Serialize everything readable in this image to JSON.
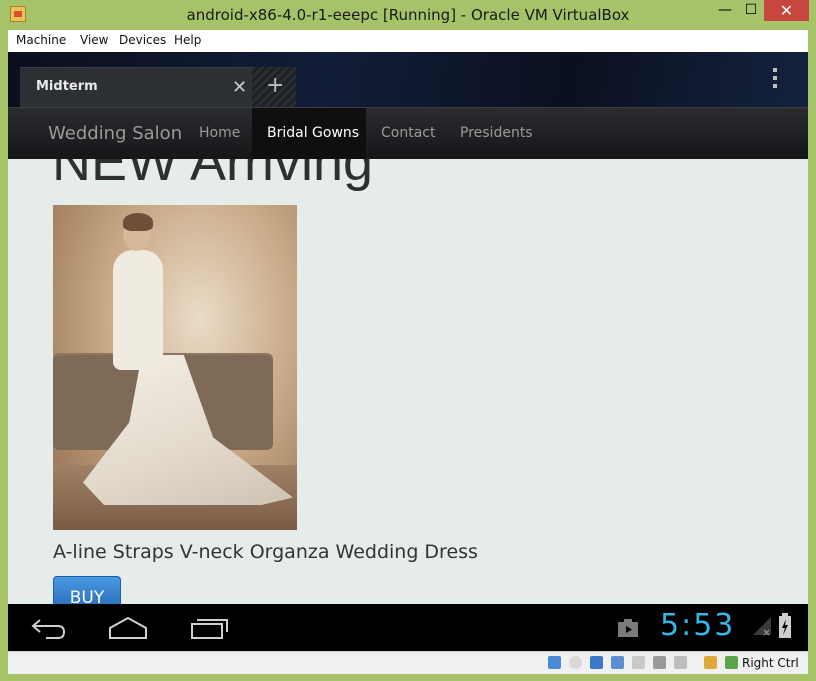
{
  "window": {
    "title": "android-x86-4.0-r1-eeepc [Running] - Oracle VM VirtualBox",
    "minimize": "—",
    "maximize": "☐",
    "close": "✕"
  },
  "menu": [
    "Machine",
    "View",
    "Devices",
    "Help"
  ],
  "browser": {
    "tab_title": "Midterm",
    "tab_close": "✕",
    "new_tab": "+"
  },
  "site": {
    "brand": "Wedding Salon",
    "nav": [
      "Home",
      "Bridal Gowns",
      "Contact",
      "Presidents"
    ],
    "active_nav": "Bridal Gowns",
    "headline": "NEW Arriving",
    "product_name": "A-line Straps V-neck Organza Wedding Dress",
    "buy_label": "BUY"
  },
  "android": {
    "clock": "5:53",
    "nav_icons": [
      "back-icon",
      "home-icon",
      "recent-apps-icon"
    ]
  },
  "statusbar": {
    "host_key": "Right Ctrl"
  },
  "colors": {
    "frame": "#a6c36a",
    "accent_blue": "#33b5e5",
    "buy_button": "#2f7fd0",
    "page_bg": "#e6ecea"
  }
}
